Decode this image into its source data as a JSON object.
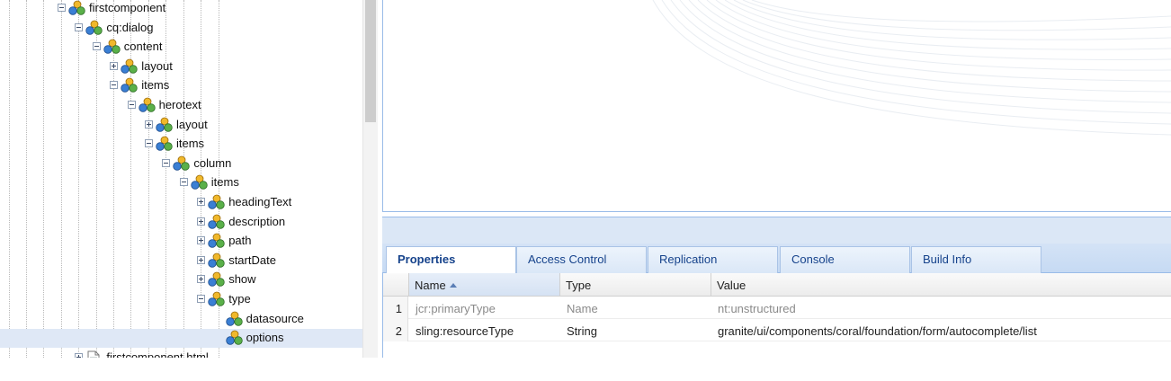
{
  "tree": {
    "nodes": [
      {
        "label": "firstcomponent",
        "depth": 0,
        "expander": "minus",
        "icon": "node"
      },
      {
        "label": "cq:dialog",
        "depth": 1,
        "expander": "minus",
        "icon": "node"
      },
      {
        "label": "content",
        "depth": 2,
        "expander": "minus",
        "icon": "node"
      },
      {
        "label": "layout",
        "depth": 3,
        "expander": "plus",
        "icon": "node"
      },
      {
        "label": "items",
        "depth": 3,
        "expander": "minus",
        "icon": "node"
      },
      {
        "label": "herotext",
        "depth": 4,
        "expander": "minus",
        "icon": "node"
      },
      {
        "label": "layout",
        "depth": 5,
        "expander": "plus",
        "icon": "node"
      },
      {
        "label": "items",
        "depth": 5,
        "expander": "minus",
        "icon": "node"
      },
      {
        "label": "column",
        "depth": 6,
        "expander": "minus",
        "icon": "node"
      },
      {
        "label": "items",
        "depth": 7,
        "expander": "minus",
        "icon": "node"
      },
      {
        "label": "headingText",
        "depth": 8,
        "expander": "plus",
        "icon": "node"
      },
      {
        "label": "description",
        "depth": 8,
        "expander": "plus",
        "icon": "node"
      },
      {
        "label": "path",
        "depth": 8,
        "expander": "plus",
        "icon": "node"
      },
      {
        "label": "startDate",
        "depth": 8,
        "expander": "plus",
        "icon": "node"
      },
      {
        "label": "show",
        "depth": 8,
        "expander": "plus",
        "icon": "node"
      },
      {
        "label": "type",
        "depth": 8,
        "expander": "minus",
        "icon": "node"
      },
      {
        "label": "datasource",
        "depth": 9,
        "expander": "none",
        "icon": "node"
      },
      {
        "label": "options",
        "depth": 9,
        "expander": "none",
        "icon": "node",
        "selected": true
      },
      {
        "label": "firstcomponent.html",
        "depth": 1,
        "expander": "plus",
        "icon": "file"
      }
    ]
  },
  "tabs": [
    "Properties",
    "Access Control",
    "Replication",
    "Console",
    "Build Info"
  ],
  "active_tab": "Properties",
  "grid": {
    "columns": [
      {
        "label": "Name",
        "sorted": "asc"
      },
      {
        "label": "Type"
      },
      {
        "label": "Value"
      }
    ],
    "rows": [
      {
        "num": "1",
        "name": "jcr:primaryType",
        "type": "Name",
        "value": "nt:unstructured",
        "muted": true
      },
      {
        "num": "2",
        "name": "sling:resourceType",
        "type": "String",
        "value": "granite/ui/components/coral/foundation/form/autocomplete/list",
        "muted": false
      }
    ]
  }
}
